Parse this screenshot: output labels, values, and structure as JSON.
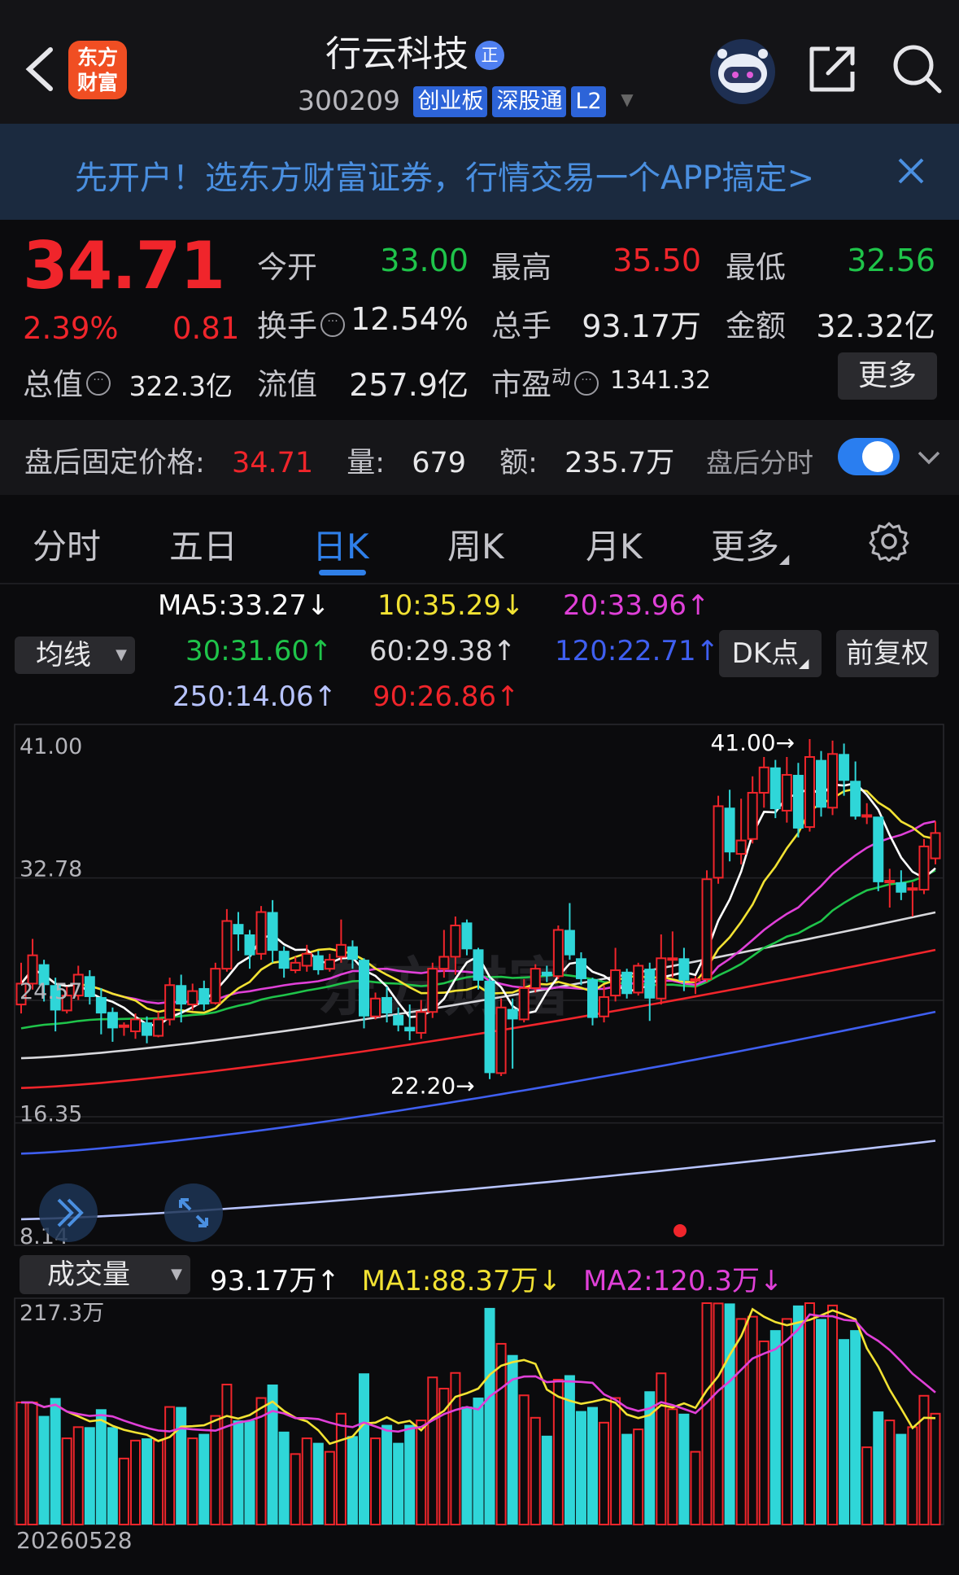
{
  "header": {
    "logo_line1": "东方",
    "logo_line2": "财富",
    "stock_name": "行云科技",
    "name_badge": "正",
    "stock_code": "300209",
    "tags": [
      "创业板",
      "深股通",
      "L2"
    ]
  },
  "banner": {
    "text": "先开户！选东方财富证券，行情交易一个APP搞定>"
  },
  "quote": {
    "price": "34.71",
    "change_pct": "2.39%",
    "change": "0.81",
    "fields": [
      {
        "label": "今开",
        "value": "33.00",
        "color": "#1fc44a"
      },
      {
        "label": "最高",
        "value": "35.50",
        "color": "#f0252b"
      },
      {
        "label": "最低",
        "value": "32.56",
        "color": "#1fc44a"
      },
      {
        "label": "换手",
        "value": "12.54%",
        "color": "#e8e8ea"
      },
      {
        "label": "总手",
        "value": "93.17万",
        "color": "#e8e8ea"
      },
      {
        "label": "金额",
        "value": "32.32亿",
        "color": "#e8e8ea"
      },
      {
        "label": "总值",
        "value": "322.3亿",
        "color": "#e8e8ea"
      },
      {
        "label": "流值",
        "value": "257.9亿",
        "color": "#e8e8ea"
      },
      {
        "label": "市盈",
        "label_sup": "动",
        "value": "1341.32",
        "color": "#e8e8ea"
      }
    ],
    "more_button": "更多"
  },
  "after_hours": {
    "label": "盘后固定价格:",
    "price": "34.71",
    "vol_label": "量:",
    "vol": "679",
    "amount_label": "额:",
    "amount": "235.7万",
    "toggle_label": "盘后分时",
    "toggle_on": true
  },
  "tabs": [
    "分时",
    "五日",
    "日K",
    "周K",
    "月K",
    "更多"
  ],
  "active_tab": "日K",
  "ma_legend": {
    "selector": "均线",
    "items": [
      {
        "text": "MA5:33.27↓",
        "color": "#ffffff"
      },
      {
        "text": "10:35.29↓",
        "color": "#f2e233"
      },
      {
        "text": "20:33.96↑",
        "color": "#e040d8"
      },
      {
        "text": "30:31.60↑",
        "color": "#1fc44a"
      },
      {
        "text": "60:29.38↑",
        "color": "#d8d8dc"
      },
      {
        "text": "120:22.71↑",
        "color": "#3f5ff0"
      },
      {
        "text": "250:14.06↑",
        "color": "#b8c4ff"
      },
      {
        "text": "90:26.86↑",
        "color": "#f0252b"
      }
    ],
    "dk_button": "DK点",
    "adjust_button": "前复权"
  },
  "chart_data": {
    "type": "candlestick",
    "y_axis_labels": [
      "41.00",
      "32.78",
      "24.57",
      "16.35",
      "8.14"
    ],
    "ylim": [
      8.14,
      41.0
    ],
    "annotations": [
      {
        "text": "41.00→",
        "value": 41.0
      },
      {
        "text": "22.20→",
        "value": 22.2
      }
    ],
    "watermark": "东方财富",
    "candles": [
      [
        23.2,
        24.6,
        22.6,
        26.0
      ],
      [
        24.6,
        26.5,
        24.2,
        27.6
      ],
      [
        25.9,
        24.5,
        23.4,
        26.2
      ],
      [
        24.5,
        22.8,
        21.4,
        25.0
      ],
      [
        22.8,
        23.8,
        22.6,
        24.4
      ],
      [
        23.8,
        25.2,
        23.5,
        25.8
      ],
      [
        25.1,
        23.7,
        23.2,
        25.5
      ],
      [
        23.7,
        22.6,
        21.2,
        24.3
      ],
      [
        22.7,
        21.6,
        20.7,
        23.0
      ],
      [
        21.7,
        21.8,
        21.1,
        22.0
      ],
      [
        21.4,
        22.2,
        20.9,
        22.6
      ],
      [
        22.0,
        21.1,
        20.6,
        22.4
      ],
      [
        21.1,
        22.2,
        21.0,
        22.7
      ],
      [
        22.2,
        24.5,
        21.8,
        25.0
      ],
      [
        24.5,
        23.2,
        22.0,
        25.2
      ],
      [
        23.2,
        24.1,
        22.8,
        24.6
      ],
      [
        24.3,
        23.2,
        22.8,
        24.8
      ],
      [
        23.3,
        25.6,
        23.2,
        26.0
      ],
      [
        25.6,
        28.8,
        25.4,
        29.6
      ],
      [
        28.6,
        27.9,
        26.8,
        29.4
      ],
      [
        27.9,
        26.5,
        25.6,
        28.2
      ],
      [
        26.6,
        29.4,
        26.2,
        29.8
      ],
      [
        29.4,
        26.8,
        26.0,
        30.2
      ],
      [
        26.8,
        25.6,
        25.0,
        27.1
      ],
      [
        25.5,
        26.0,
        25.3,
        26.4
      ],
      [
        25.8,
        26.6,
        25.4,
        27.2
      ],
      [
        26.5,
        25.5,
        25.2,
        26.8
      ],
      [
        25.6,
        26.2,
        25.4,
        26.6
      ],
      [
        26.4,
        27.2,
        26.0,
        28.9
      ],
      [
        27.1,
        26.2,
        25.6,
        27.5
      ],
      [
        26.2,
        22.4,
        21.6,
        26.3
      ],
      [
        22.4,
        23.6,
        22.2,
        24.0
      ],
      [
        23.7,
        22.6,
        22.0,
        24.4
      ],
      [
        22.5,
        21.8,
        21.4,
        23.0
      ],
      [
        21.7,
        21.4,
        20.8,
        23.2
      ],
      [
        21.3,
        22.7,
        20.9,
        23.5
      ],
      [
        22.7,
        25.6,
        22.3,
        26.0
      ],
      [
        25.6,
        26.4,
        25.0,
        28.2
      ],
      [
        26.4,
        28.5,
        25.2,
        29.1
      ],
      [
        28.7,
        26.9,
        26.5,
        28.9
      ],
      [
        26.9,
        24.8,
        24.2,
        27.0
      ],
      [
        24.8,
        18.6,
        18.2,
        25.0
      ],
      [
        18.6,
        23.0,
        18.4,
        23.6
      ],
      [
        22.9,
        22.2,
        18.9,
        23.6
      ],
      [
        22.2,
        24.3,
        22.0,
        24.9
      ],
      [
        24.3,
        25.6,
        24.0,
        25.9
      ],
      [
        25.4,
        25.1,
        24.7,
        25.8
      ],
      [
        25.1,
        28.2,
        24.9,
        28.5
      ],
      [
        28.2,
        26.5,
        26.2,
        30.0
      ],
      [
        26.3,
        24.9,
        24.5,
        26.7
      ],
      [
        24.9,
        22.3,
        21.8,
        25.0
      ],
      [
        22.4,
        23.7,
        22.0,
        24.5
      ],
      [
        23.8,
        25.5,
        23.4,
        27.0
      ],
      [
        25.4,
        23.9,
        23.6,
        25.6
      ],
      [
        24.0,
        25.8,
        23.8,
        26.0
      ],
      [
        25.6,
        23.6,
        22.1,
        26.0
      ],
      [
        23.6,
        26.3,
        23.2,
        27.9
      ],
      [
        26.3,
        26.3,
        25.0,
        28.1
      ],
      [
        26.3,
        24.8,
        24.1,
        27.0
      ],
      [
        24.8,
        24.9,
        23.9,
        25.1
      ],
      [
        24.9,
        31.6,
        24.7,
        32.2
      ],
      [
        31.7,
        36.5,
        31.3,
        37.2
      ],
      [
        36.4,
        33.4,
        32.8,
        37.6
      ],
      [
        33.3,
        34.2,
        32.6,
        37.0
      ],
      [
        34.3,
        37.4,
        34.0,
        38.5
      ],
      [
        37.4,
        39.1,
        36.4,
        39.8
      ],
      [
        39.1,
        36.3,
        35.7,
        39.6
      ],
      [
        36.2,
        38.6,
        35.4,
        39.8
      ],
      [
        38.6,
        35.0,
        34.4,
        39.4
      ],
      [
        35.1,
        39.8,
        34.8,
        41.0
      ],
      [
        39.6,
        36.4,
        35.8,
        40.2
      ],
      [
        36.4,
        40.0,
        35.9,
        40.9
      ],
      [
        40.0,
        38.2,
        37.2,
        40.7
      ],
      [
        38.2,
        35.8,
        35.6,
        39.5
      ],
      [
        35.8,
        35.9,
        35.3,
        36.7
      ],
      [
        35.8,
        31.4,
        30.8,
        33.8
      ],
      [
        31.4,
        31.5,
        29.7,
        32.3
      ],
      [
        31.4,
        30.7,
        30.2,
        32.2
      ],
      [
        30.9,
        31.0,
        29.1,
        31.4
      ],
      [
        30.9,
        33.8,
        30.6,
        34.3
      ],
      [
        33.0,
        34.7,
        32.6,
        35.5
      ]
    ]
  },
  "volume": {
    "selector": "成交量",
    "legend": [
      {
        "text": "93.17万↑",
        "color": "#ffffff"
      },
      {
        "text": "MA1:88.37万↓",
        "color": "#f2e233"
      },
      {
        "text": "MA2:120.3万↓",
        "color": "#e040d8"
      }
    ],
    "y_max_label": "217.3万",
    "date_label": "20260528"
  }
}
